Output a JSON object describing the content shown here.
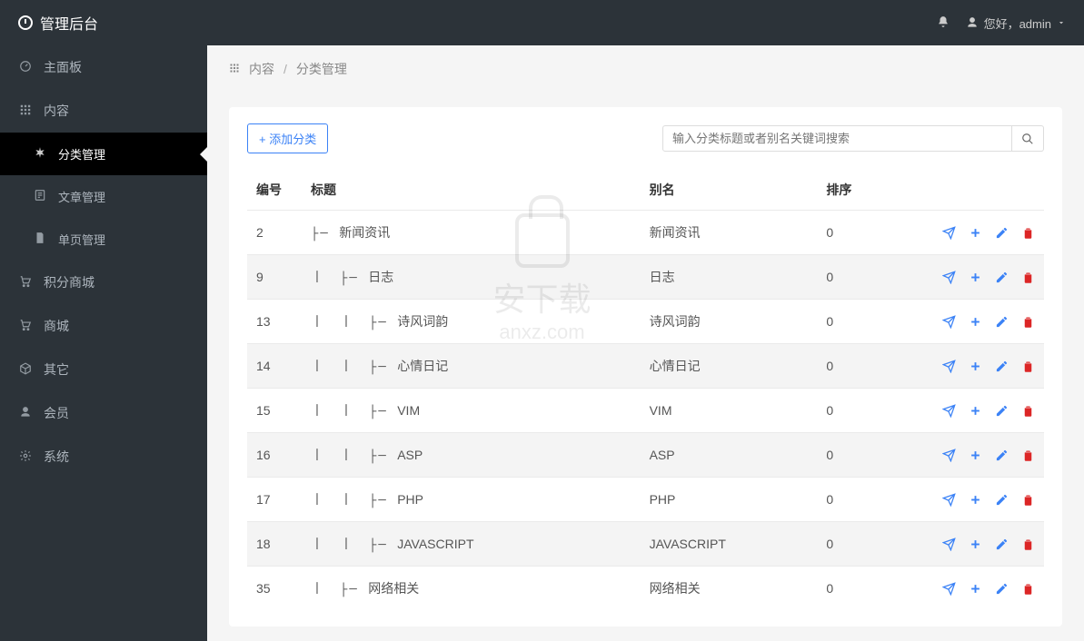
{
  "brand": "管理后台",
  "user": {
    "greeting": "您好，admin"
  },
  "sidebar": {
    "items": [
      {
        "label": "主面板",
        "icon": "dashboard"
      },
      {
        "label": "内容",
        "icon": "grid"
      },
      {
        "label": "分类管理",
        "icon": "asterisk",
        "sub": true,
        "active": true
      },
      {
        "label": "文章管理",
        "icon": "article",
        "sub": true
      },
      {
        "label": "单页管理",
        "icon": "page",
        "sub": true
      },
      {
        "label": "积分商城",
        "icon": "cart"
      },
      {
        "label": "商城",
        "icon": "cart"
      },
      {
        "label": "其它",
        "icon": "cube"
      },
      {
        "label": "会员",
        "icon": "user"
      },
      {
        "label": "系统",
        "icon": "gear"
      }
    ]
  },
  "breadcrumb": {
    "root": "内容",
    "current": "分类管理"
  },
  "toolbar": {
    "add_label": "+ 添加分类",
    "search_placeholder": "输入分类标题或者别名关键词搜索"
  },
  "table": {
    "headers": {
      "id": "编号",
      "title": "标题",
      "alias": "别名",
      "sort": "排序"
    },
    "rows": [
      {
        "id": "2",
        "depth": 1,
        "title": "新闻资讯",
        "alias": "新闻资讯",
        "sort": "0"
      },
      {
        "id": "9",
        "depth": 2,
        "title": "日志",
        "alias": "日志",
        "sort": "0"
      },
      {
        "id": "13",
        "depth": 3,
        "title": "诗风词韵",
        "alias": "诗风词韵",
        "sort": "0"
      },
      {
        "id": "14",
        "depth": 3,
        "title": "心情日记",
        "alias": "心情日记",
        "sort": "0"
      },
      {
        "id": "15",
        "depth": 3,
        "title": "VIM",
        "alias": "VIM",
        "sort": "0"
      },
      {
        "id": "16",
        "depth": 3,
        "title": "ASP",
        "alias": "ASP",
        "sort": "0"
      },
      {
        "id": "17",
        "depth": 3,
        "title": "PHP",
        "alias": "PHP",
        "sort": "0"
      },
      {
        "id": "18",
        "depth": 3,
        "title": "JAVASCRIPT",
        "alias": "JAVASCRIPT",
        "sort": "0"
      },
      {
        "id": "35",
        "depth": 2,
        "title": "网络相关",
        "alias": "网络相关",
        "sort": "0"
      }
    ]
  },
  "watermark": {
    "text": "安下载",
    "url": "anxz.com"
  }
}
